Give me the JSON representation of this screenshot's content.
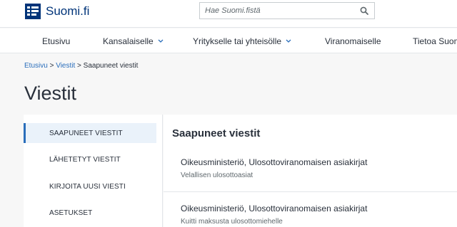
{
  "header": {
    "logo_text": "Suomi.fi",
    "search": {
      "placeholder": "Hae Suomi.fistä"
    },
    "icons": {
      "logo": "suomifi-logo-icon",
      "search": "search-icon"
    }
  },
  "nav": {
    "items": [
      {
        "label": "Etusivu",
        "has_dropdown": false
      },
      {
        "label": "Kansalaiselle",
        "has_dropdown": true
      },
      {
        "label": "Yritykselle tai yhteisölle",
        "has_dropdown": true
      },
      {
        "label": "Viranomaiselle",
        "has_dropdown": false
      },
      {
        "label": "Tietoa Suom",
        "has_dropdown": false
      }
    ]
  },
  "breadcrumb": {
    "items": [
      "Etusivu",
      "Viestit"
    ],
    "separator": ">",
    "current": "Saapuneet viestit"
  },
  "page": {
    "title": "Viestit"
  },
  "sidebar": {
    "items": [
      {
        "label": "SAAPUNEET VIESTIT",
        "active": true
      },
      {
        "label": "LÄHETETYT VIESTIT",
        "active": false
      },
      {
        "label": "KIRJOITA UUSI VIESTI",
        "active": false
      },
      {
        "label": "ASETUKSET",
        "active": false
      }
    ]
  },
  "inbox": {
    "title": "Saapuneet viestit",
    "messages": [
      {
        "sender": "Oikeusministeriö, Ulosottoviranomaisen asiakirjat",
        "subject": "Velallisen ulosottoasiat"
      },
      {
        "sender": "Oikeusministeriö, Ulosottoviranomaisen asiakirjat",
        "subject": "Kuitti maksusta ulosottomiehelle"
      }
    ]
  },
  "colors": {
    "brand": "#003479",
    "link": "#2a6ebb",
    "active_bg": "#eaf2fa",
    "page_bg": "#f7f7f7",
    "text": "#29303b",
    "muted": "#5f686d"
  }
}
